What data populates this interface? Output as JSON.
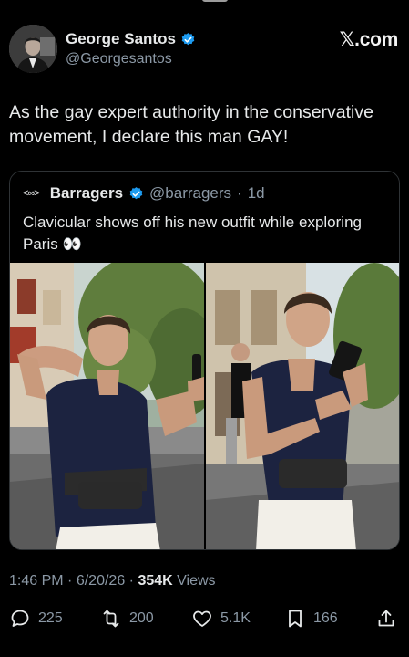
{
  "author": {
    "name": "George Santos",
    "handle": "@Georgesantos"
  },
  "brand": "𝕏.com",
  "tweet_text": "As the gay expert authority in the conservative movement, I declare this man GAY!",
  "quoted": {
    "logo": "<∞>",
    "name": "Barragers",
    "handle": "@barragers",
    "separator": "·",
    "time": "1d",
    "text": "Clavicular shows off his new outfit while exploring Paris 👀"
  },
  "meta": {
    "time": "1:46 PM",
    "separator": "·",
    "date": "6/20/26",
    "separator2": "·",
    "views_count": "354K",
    "views_label": "Views"
  },
  "actions": {
    "replies": "225",
    "reposts": "200",
    "likes": "5.1K",
    "bookmarks": "166"
  },
  "colors": {
    "background": "#000000",
    "verified": "#1d9bf0",
    "muted": "#8b98a5",
    "text": "#e7e9ea"
  }
}
